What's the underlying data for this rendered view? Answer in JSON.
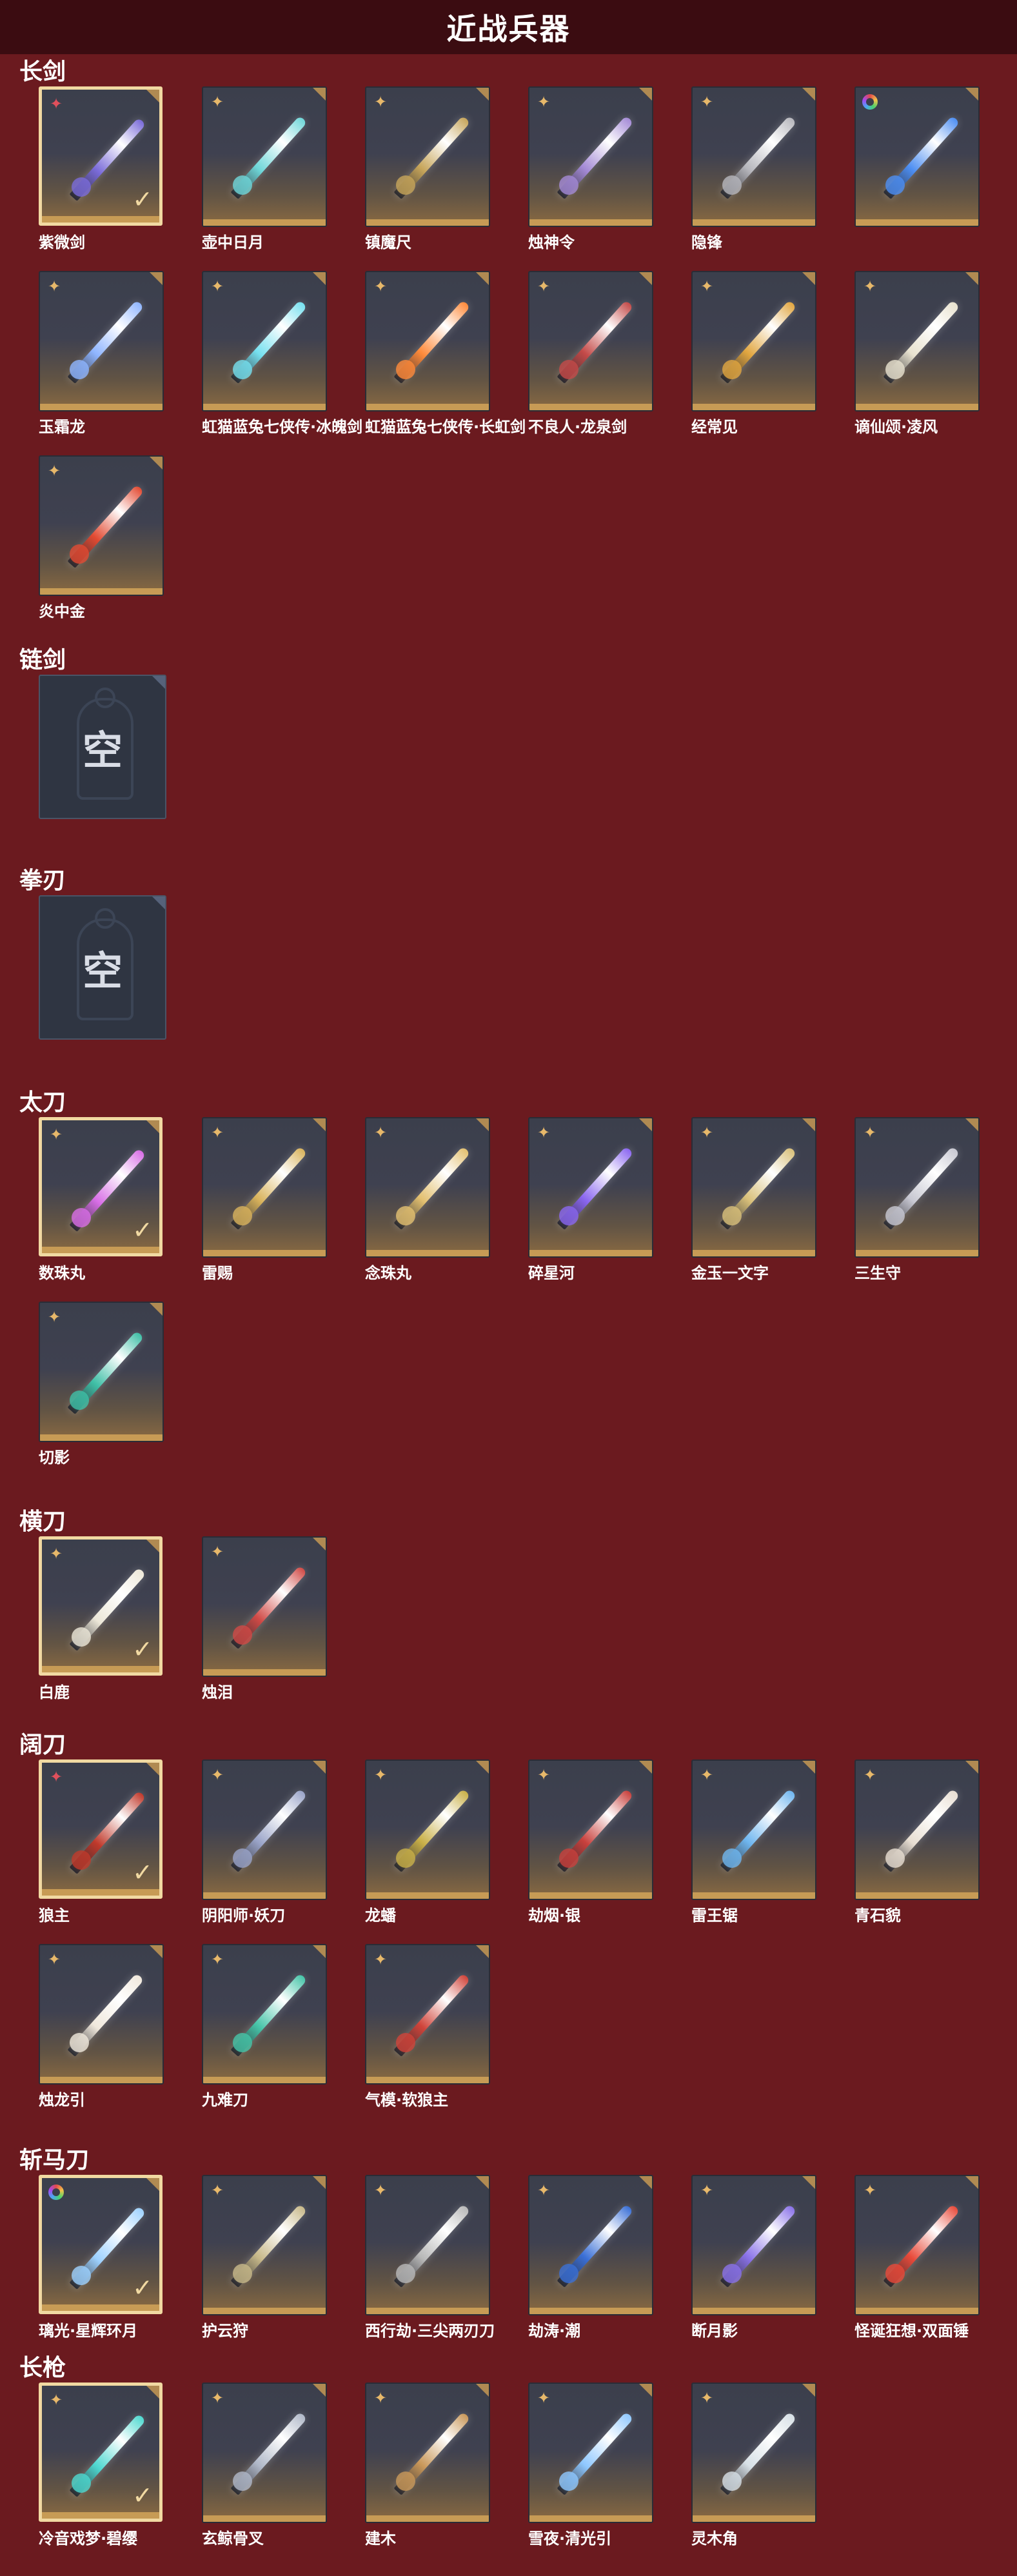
{
  "page": {
    "title": "近战兵器"
  },
  "colors": {
    "background": "#6b1a1f",
    "header": "#3b0c11",
    "selected_border": "#f1d9a2",
    "tile_bar": "#c79b55"
  },
  "empty_label": "空",
  "sections": [
    {
      "title": "长剑",
      "items": [
        {
          "name": "紫微剑",
          "rarity": "red",
          "selected": true,
          "color": "#7a6bd9"
        },
        {
          "name": "壶中日月",
          "rarity": "gold",
          "selected": false,
          "color": "#6fd7d9"
        },
        {
          "name": "镇魔尺",
          "rarity": "gold",
          "selected": false,
          "color": "#c7a55a"
        },
        {
          "name": "烛神令",
          "rarity": "gold",
          "selected": false,
          "color": "#a48ad6"
        },
        {
          "name": "隐锋",
          "rarity": "gold",
          "selected": false,
          "color": "#b7b7bd"
        },
        {
          "name": "",
          "rarity": "rainbow",
          "selected": false,
          "color": "#4d8ef2"
        },
        {
          "name": "玉霜龙",
          "rarity": "gold",
          "selected": false,
          "color": "#8fb5ff"
        },
        {
          "name": "虹猫蓝兔七侠传·冰魄剑",
          "rarity": "gold",
          "selected": false,
          "color": "#76e0ef"
        },
        {
          "name": "虹猫蓝兔七侠传·长虹剑",
          "rarity": "gold",
          "selected": false,
          "color": "#ff8a3a"
        },
        {
          "name": "不良人·龙泉剑",
          "rarity": "gold",
          "selected": false,
          "color": "#c44a48"
        },
        {
          "name": "经常见",
          "rarity": "gold",
          "selected": false,
          "color": "#e1a640"
        },
        {
          "name": "谪仙颂·凌风",
          "rarity": "gold",
          "selected": false,
          "color": "#e8e2cf"
        },
        {
          "name": "炎中金",
          "rarity": "gold",
          "selected": false,
          "color": "#e24a32"
        }
      ]
    },
    {
      "title": "链剑",
      "items": [],
      "empty": true
    },
    {
      "title": "拳刃",
      "items": [],
      "empty": true
    },
    {
      "title": "太刀",
      "items": [
        {
          "name": "数珠丸",
          "rarity": "gold",
          "selected": true,
          "color": "#d86ee6"
        },
        {
          "name": "雷赐",
          "rarity": "gold",
          "selected": false,
          "color": "#d9b35c"
        },
        {
          "name": "念珠丸",
          "rarity": "gold",
          "selected": false,
          "color": "#e3c070"
        },
        {
          "name": "碎星河",
          "rarity": "gold",
          "selected": false,
          "color": "#8a66f0"
        },
        {
          "name": "金玉一文字",
          "rarity": "gold",
          "selected": false,
          "color": "#d9c07a"
        },
        {
          "name": "三生守",
          "rarity": "gold",
          "selected": false,
          "color": "#c8c8d2"
        },
        {
          "name": "切影",
          "rarity": "gold",
          "selected": false,
          "color": "#3fbfa6"
        }
      ]
    },
    {
      "title": "横刀",
      "items": [
        {
          "name": "白鹿",
          "rarity": "gold",
          "selected": true,
          "color": "#ece7d8"
        },
        {
          "name": "烛泪",
          "rarity": "gold",
          "selected": false,
          "color": "#d04a46"
        }
      ]
    },
    {
      "title": "阔刀",
      "items": [
        {
          "name": "狼主",
          "rarity": "red",
          "selected": true,
          "color": "#c0392b"
        },
        {
          "name": "阴阳师·妖刀",
          "rarity": "gold",
          "selected": false,
          "color": "#9aa4c8"
        },
        {
          "name": "龙蟠",
          "rarity": "gold",
          "selected": false,
          "color": "#c9b048"
        },
        {
          "name": "劫烟·银",
          "rarity": "gold",
          "selected": false,
          "color": "#c8403c"
        },
        {
          "name": "雷王锯",
          "rarity": "gold",
          "selected": false,
          "color": "#6fb6ef"
        },
        {
          "name": "青石貌",
          "rarity": "gold",
          "selected": false,
          "color": "#e8ded2"
        },
        {
          "name": "烛龙引",
          "rarity": "gold",
          "selected": false,
          "color": "#f0e8dc"
        },
        {
          "name": "九难刀",
          "rarity": "gold",
          "selected": false,
          "color": "#46c4a8"
        },
        {
          "name": "气模·软狼主",
          "rarity": "gold",
          "selected": false,
          "color": "#d0443a"
        }
      ]
    },
    {
      "title": "斩马刀",
      "items": [
        {
          "name": "璃光·星辉环月",
          "rarity": "rainbow",
          "selected": true,
          "color": "#9ed2ff"
        },
        {
          "name": "护云狩",
          "rarity": "gold",
          "selected": false,
          "color": "#c8b98a"
        },
        {
          "name": "西行劫·三尖两刃刀",
          "rarity": "gold",
          "selected": false,
          "color": "#b9b9b9"
        },
        {
          "name": "劫涛·潮",
          "rarity": "gold",
          "selected": false,
          "color": "#3a6fd6"
        },
        {
          "name": "断月影",
          "rarity": "gold",
          "selected": false,
          "color": "#8a72e8"
        },
        {
          "name": "怪诞狂想·双面锤",
          "rarity": "gold",
          "selected": false,
          "color": "#e84a3a"
        }
      ]
    },
    {
      "title": "长枪",
      "items": [
        {
          "name": "冷音戏梦·碧缨",
          "rarity": "gold",
          "selected": true,
          "color": "#4ed8d0"
        },
        {
          "name": "玄鲸骨叉",
          "rarity": "gold",
          "selected": false,
          "color": "#b0b8c8"
        },
        {
          "name": "建木",
          "rarity": "gold",
          "selected": false,
          "color": "#c9985a"
        },
        {
          "name": "雪夜·清光引",
          "rarity": "gold",
          "selected": false,
          "color": "#8fc8ff"
        },
        {
          "name": "灵木角",
          "rarity": "gold",
          "selected": false,
          "color": "#d7e0e6"
        }
      ]
    }
  ]
}
